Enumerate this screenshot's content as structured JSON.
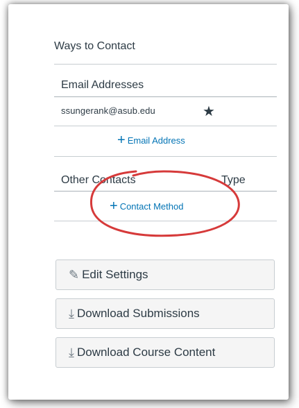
{
  "panel": {
    "heading": "Ways to Contact",
    "email_section": {
      "title": "Email Addresses",
      "email": "ssungerank@asub.edu",
      "add_label": "Email Address"
    },
    "other_section": {
      "title": "Other Contacts",
      "type_header": "Type",
      "add_label": "Contact Method"
    }
  },
  "buttons": {
    "edit_settings": "Edit Settings",
    "download_submissions": "Download Submissions",
    "download_course_content": "Download Course Content"
  },
  "colors": {
    "link": "#0374b5",
    "annotation": "#d63a3a",
    "text": "#2d3b45"
  },
  "icons": {
    "star": "star-icon",
    "plus": "plus-icon",
    "pencil": "pencil-icon",
    "download": "download-icon"
  }
}
